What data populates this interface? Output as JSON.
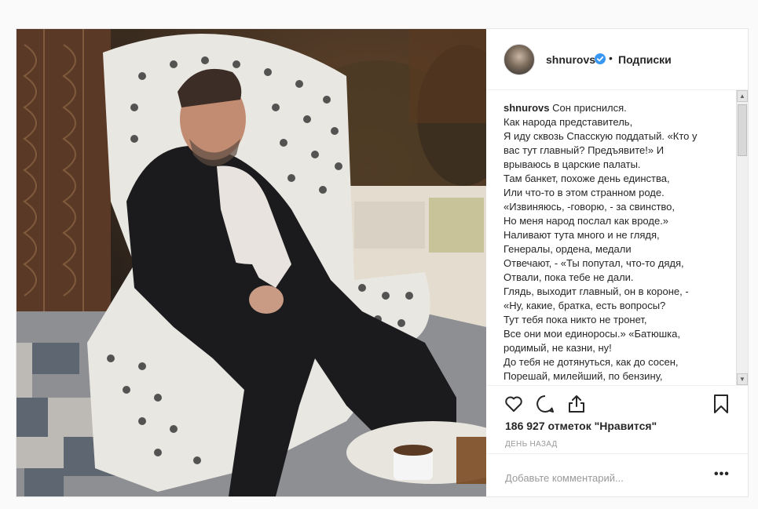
{
  "post": {
    "username": "shnurovs",
    "verified": true,
    "separator": "•",
    "follow_label": "Подписки",
    "caption_username": "shnurovs",
    "caption_lines": [
      "Сон приснился.",
      "Как народа представитель,",
      "Я иду сквозь Спасскую поддатый. «Кто у",
      "вас тут главный? Предъявите!» И",
      "врываюсь в царские палаты.",
      "Там банкет, похоже день единства,",
      "Или что-то в этом странном роде.",
      "«Извиняюсь, -говорю, - за свинство,",
      "Но меня народ послал как вроде.»",
      "Наливают тута много и не глядя,",
      "Генералы, ордена, медали",
      "Отвечают, - «Ты попутал, что-то дядя,",
      "Отвали, пока тебе не дали.",
      "Глядь, выходит главный, он в короне, -",
      "«Ну, какие, братка, есть вопросы?",
      "Тут тебя пока никто не тронет,",
      "Все они мои единоросы.» «Батюшка,",
      "родимый, не казни, ну!",
      "До тебя не дотянуться, как до сосен,",
      "Порешай, милейший, по бензину,"
    ],
    "likes": "186 927 отметок \"Нравится\"",
    "time": "день назад",
    "comment_placeholder": "Добавьте комментарий...",
    "more_label": "•••",
    "icons": {
      "like": "heart-icon",
      "comment": "comment-icon",
      "share": "share-icon",
      "save": "bookmark-icon",
      "verified": "verified-badge-icon"
    },
    "colors": {
      "verified": "#3897f0",
      "text": "#262626",
      "muted": "#999999",
      "border": "#efefef"
    }
  }
}
